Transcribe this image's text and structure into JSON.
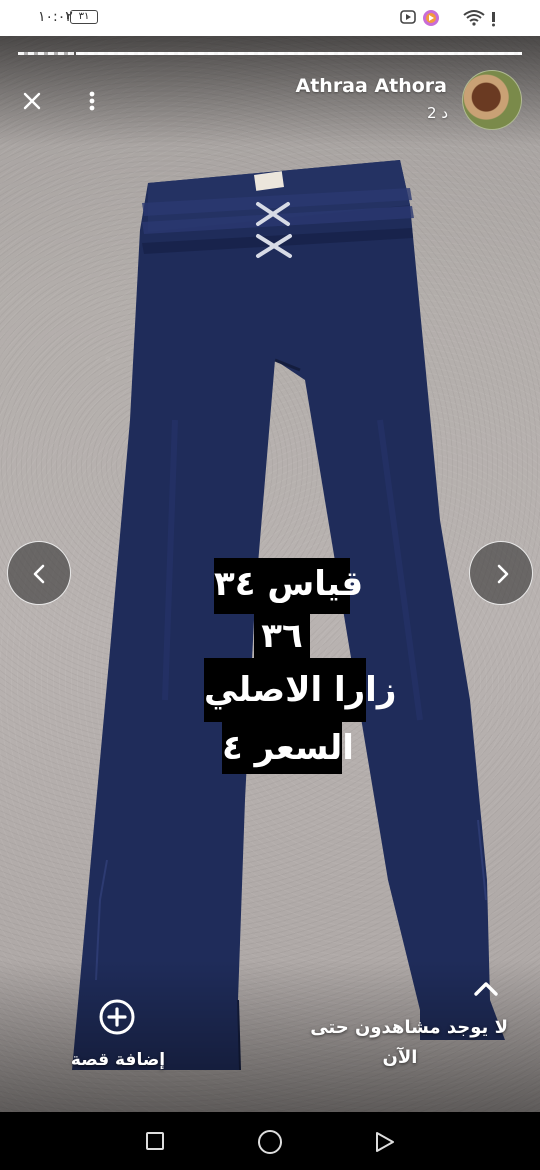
{
  "status_bar": {
    "time": "١٠:٠٢",
    "battery": "٣١",
    "icons": [
      "wifi-icon",
      "youtube-icon",
      "circle-app-icon"
    ]
  },
  "story": {
    "author": "Athraa Athora",
    "time_ago": "2 د",
    "segments": 4,
    "active_segment": 4,
    "text_lines": [
      "قياس ٣٤",
      "٣٦",
      "زارا الاصلي",
      "السعر ٤"
    ]
  },
  "actions": {
    "add_story_label": "إضافة قصة",
    "viewers_line1": "لا يوجد مشاهدون حتى",
    "viewers_line2": "الآن"
  },
  "colors": {
    "pants": "#1f2c5a",
    "carpet": "#b3aeab",
    "sticker_bg": "#000000"
  }
}
